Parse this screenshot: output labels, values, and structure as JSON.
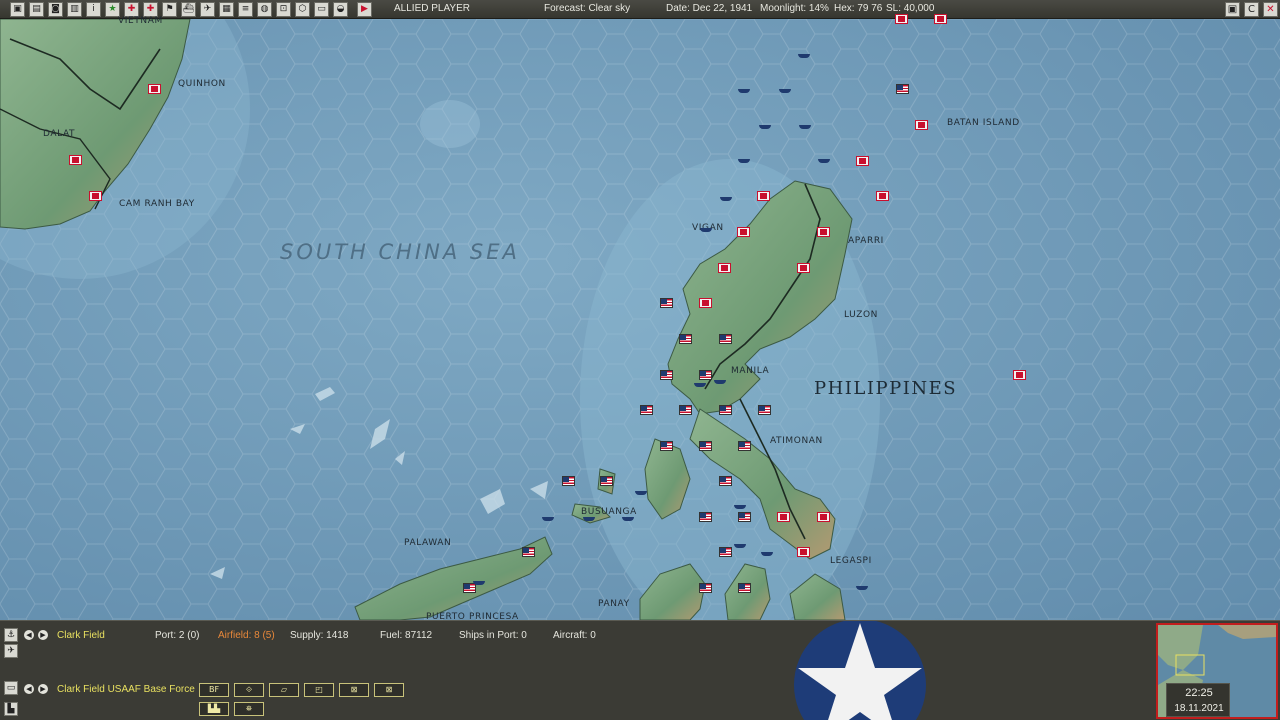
{
  "toolbar": {
    "buttons": [
      {
        "name": "home-icon",
        "glyph": "▣"
      },
      {
        "name": "report-icon",
        "glyph": "▤"
      },
      {
        "name": "screenshot-icon",
        "glyph": "◙"
      },
      {
        "name": "printer-icon",
        "glyph": "▥"
      },
      {
        "name": "info-icon",
        "glyph": "i"
      },
      {
        "name": "star-icon",
        "glyph": "★"
      },
      {
        "name": "target-icon",
        "glyph": "✚"
      },
      {
        "name": "cross-icon",
        "glyph": "✚"
      },
      {
        "name": "flag-icon",
        "glyph": "⚑"
      },
      {
        "name": "ship-icon",
        "glyph": "⛴"
      },
      {
        "name": "plane-icon",
        "glyph": "✈"
      },
      {
        "name": "base-icon",
        "glyph": "▦"
      },
      {
        "name": "routes-icon",
        "glyph": "≡"
      },
      {
        "name": "globe-icon",
        "glyph": "◍"
      },
      {
        "name": "zoom-icon",
        "glyph": "⊡"
      },
      {
        "name": "hex-icon",
        "glyph": "⬡"
      },
      {
        "name": "panel-icon",
        "glyph": "▭"
      },
      {
        "name": "weather-icon",
        "glyph": "◒"
      },
      {
        "name": "end-turn-icon",
        "glyph": "▶"
      }
    ],
    "player": "ALLIED PLAYER",
    "forecast": "Forecast: Clear sky",
    "date": "Date: Dec 22, 1941",
    "moonlight": "Moonlight: 14%",
    "hex": "Hex: 79 76",
    "sl": "SL: 40,000",
    "right_buttons": [
      {
        "name": "log-icon",
        "glyph": "▣"
      },
      {
        "name": "c-icon",
        "glyph": "C"
      },
      {
        "name": "close-icon",
        "glyph": "✕"
      }
    ]
  },
  "map": {
    "sea": "SOUTH CHINA SEA",
    "country": "PHILIPPINES",
    "places": [
      {
        "id": "vietnam",
        "text": "VIETNAM"
      },
      {
        "id": "quinhon",
        "text": "QUINHON"
      },
      {
        "id": "dalat",
        "text": "DALAT"
      },
      {
        "id": "camranh",
        "text": "CAM RANH BAY"
      },
      {
        "id": "batan",
        "text": "BATAN ISLAND"
      },
      {
        "id": "vigan",
        "text": "VIGAN"
      },
      {
        "id": "aparri",
        "text": "APARRI"
      },
      {
        "id": "luzon",
        "text": "LUZON"
      },
      {
        "id": "manila",
        "text": "MANILA"
      },
      {
        "id": "atimonan",
        "text": "ATIMONAN"
      },
      {
        "id": "busuanga",
        "text": "BUSUANGA"
      },
      {
        "id": "palawan",
        "text": "PALAWAN"
      },
      {
        "id": "legaspi",
        "text": "LEGASPI"
      },
      {
        "id": "panay",
        "text": "PANAY"
      },
      {
        "id": "puerto",
        "text": "PUERTO PRINCESA"
      }
    ]
  },
  "panel": {
    "base_name": "Clark Field",
    "port": "Port: 2 (0)",
    "airfield": "Airfield: 8 (5)",
    "supply": "Supply: 1418",
    "fuel": "Fuel: 87112",
    "ships_in_port": "Ships in Port: 0",
    "aircraft": "Aircraft: 0",
    "unit_name": "Clark Field USAAF Base Force",
    "unit_buttons": [
      "BF",
      "",
      "",
      "",
      "",
      ""
    ],
    "time": "22:25",
    "real_date": "18.11.2021"
  },
  "colors": {
    "airfield_orange": "#e8883a",
    "base_name_yellow": "#e8e060",
    "japan_red": "#c8102e",
    "allied_blue": "#1f3a6e"
  }
}
